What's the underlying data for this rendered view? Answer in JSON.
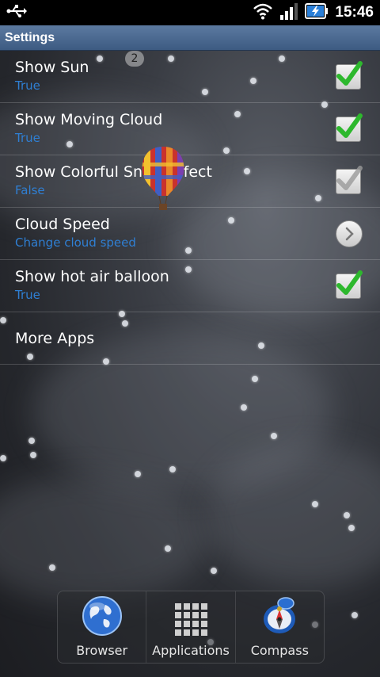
{
  "status_bar": {
    "time": "15:46",
    "icons": [
      "usb-icon",
      "wifi-icon",
      "signal-icon",
      "battery-charging-icon"
    ]
  },
  "title_bar": {
    "title": "Settings"
  },
  "page_indicator": "2",
  "settings": [
    {
      "title": "Show Sun",
      "summary": "True",
      "control": "checkbox",
      "checked": true
    },
    {
      "title": "Show Moving Cloud",
      "summary": "True",
      "control": "checkbox",
      "checked": true
    },
    {
      "title": "Show Colorful Snow Effect",
      "summary": "False",
      "control": "checkbox",
      "checked": false
    },
    {
      "title": "Cloud Speed",
      "summary": "Change cloud speed",
      "control": "chevron"
    },
    {
      "title": "Show hot air balloon",
      "summary": "True",
      "control": "checkbox",
      "checked": true
    },
    {
      "title": "More Apps"
    }
  ],
  "dock": [
    {
      "label": "Browser",
      "icon": "globe-icon"
    },
    {
      "label": "Applications",
      "icon": "grid-icon"
    },
    {
      "label": "Compass",
      "icon": "compass-icon"
    }
  ],
  "colors": {
    "accent": "#2f7fd3",
    "check_green": "#2db82d",
    "check_gray": "#9a9a9a",
    "title_bar": "#4a6a92"
  }
}
